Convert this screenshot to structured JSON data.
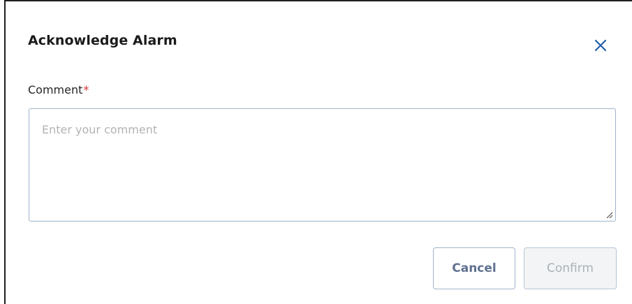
{
  "dialog": {
    "title": "Acknowledge Alarm",
    "close_icon": "close-icon",
    "comment": {
      "label": "Comment",
      "required_marker": "*",
      "placeholder": "Enter your comment",
      "value": ""
    },
    "buttons": {
      "cancel_label": "Cancel",
      "confirm_label": "Confirm",
      "confirm_disabled": true
    }
  },
  "colors": {
    "accent": "#1f5faa",
    "required": "#d32f2f",
    "border": "#9fb2c9",
    "disabled_text": "#a9b0b8"
  }
}
